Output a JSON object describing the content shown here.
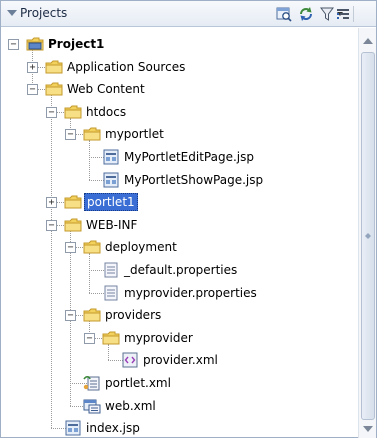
{
  "panel": {
    "title": "Projects",
    "toolbar": [
      {
        "name": "synchronize-icon",
        "dropdown": false
      },
      {
        "name": "refresh-icon",
        "dropdown": false
      },
      {
        "name": "filter-icon",
        "dropdown": true
      },
      {
        "name": "sort-icon",
        "dropdown": true
      }
    ]
  },
  "tree": [
    {
      "label": "Project1",
      "depth": 0,
      "toggle": "minus",
      "icon": "project-icon",
      "bold": true
    },
    {
      "label": "Application Sources",
      "depth": 1,
      "toggle": "plus",
      "icon": "folder-icon"
    },
    {
      "label": "Web Content",
      "depth": 1,
      "toggle": "minus",
      "icon": "folder-icon"
    },
    {
      "label": "htdocs",
      "depth": 2,
      "toggle": "minus",
      "icon": "folder-icon"
    },
    {
      "label": "myportlet",
      "depth": 3,
      "toggle": "minus",
      "icon": "folder-icon"
    },
    {
      "label": "MyPortletEditPage.jsp",
      "depth": 4,
      "toggle": null,
      "icon": "jsp-file-icon"
    },
    {
      "label": "MyPortletShowPage.jsp",
      "depth": 4,
      "toggle": null,
      "icon": "jsp-file-icon"
    },
    {
      "label": "portlet1",
      "depth": 2,
      "toggle": "plus",
      "icon": "folder-icon",
      "selected": true
    },
    {
      "label": "WEB-INF",
      "depth": 2,
      "toggle": "minus",
      "icon": "folder-icon"
    },
    {
      "label": "deployment",
      "depth": 3,
      "toggle": "minus",
      "icon": "folder-icon"
    },
    {
      "label": "_default.properties",
      "depth": 4,
      "toggle": null,
      "icon": "properties-file-icon"
    },
    {
      "label": "myprovider.properties",
      "depth": 4,
      "toggle": null,
      "icon": "properties-file-icon"
    },
    {
      "label": "providers",
      "depth": 3,
      "toggle": "minus",
      "icon": "folder-icon"
    },
    {
      "label": "myprovider",
      "depth": 4,
      "toggle": "minus",
      "icon": "folder-icon"
    },
    {
      "label": "provider.xml",
      "depth": 5,
      "toggle": null,
      "icon": "xml-file-icon"
    },
    {
      "label": "portlet.xml",
      "depth": 3,
      "toggle": null,
      "icon": "portlet-xml-icon"
    },
    {
      "label": "web.xml",
      "depth": 3,
      "toggle": null,
      "icon": "web-xml-icon"
    },
    {
      "label": "index.jsp",
      "depth": 2,
      "toggle": null,
      "icon": "jsp-file-icon"
    }
  ],
  "colors": {
    "folder": "#f2d15c",
    "folder_edge": "#c49a2c",
    "selection": "#3a6ed4",
    "tree_lines": "#9b9b9b"
  }
}
